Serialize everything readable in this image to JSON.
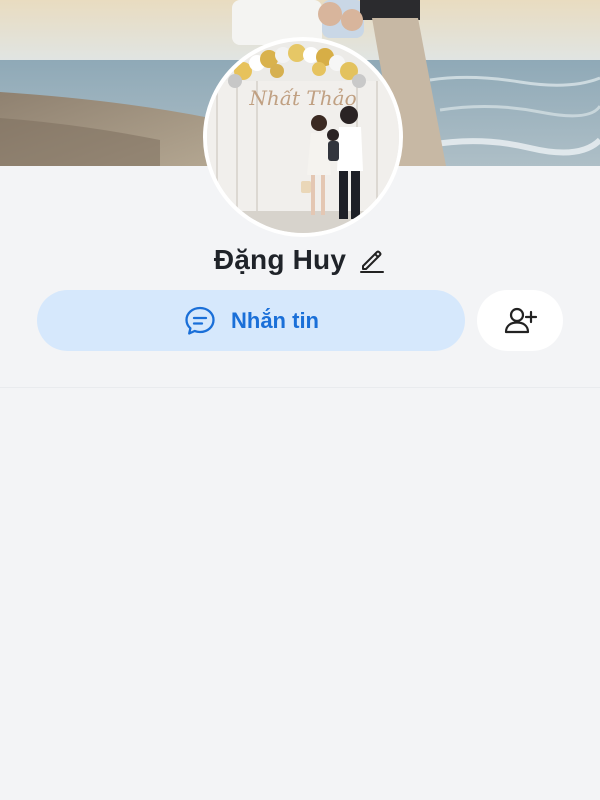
{
  "profile": {
    "name": "Đặng Huy",
    "avatar_banner_text": "Nhất Thảo"
  },
  "actions": {
    "message_label": "Nhắn tin"
  },
  "icons": {
    "edit": "pencil-icon",
    "message": "chat-bubble-icon",
    "add_friend": "add-user-icon"
  },
  "colors": {
    "page_background": "#f3f4f6",
    "message_button_bg": "#d6e8fc",
    "accent_blue": "#1a6fd8",
    "name_text": "#1f2329",
    "add_button_bg": "#ffffff"
  }
}
